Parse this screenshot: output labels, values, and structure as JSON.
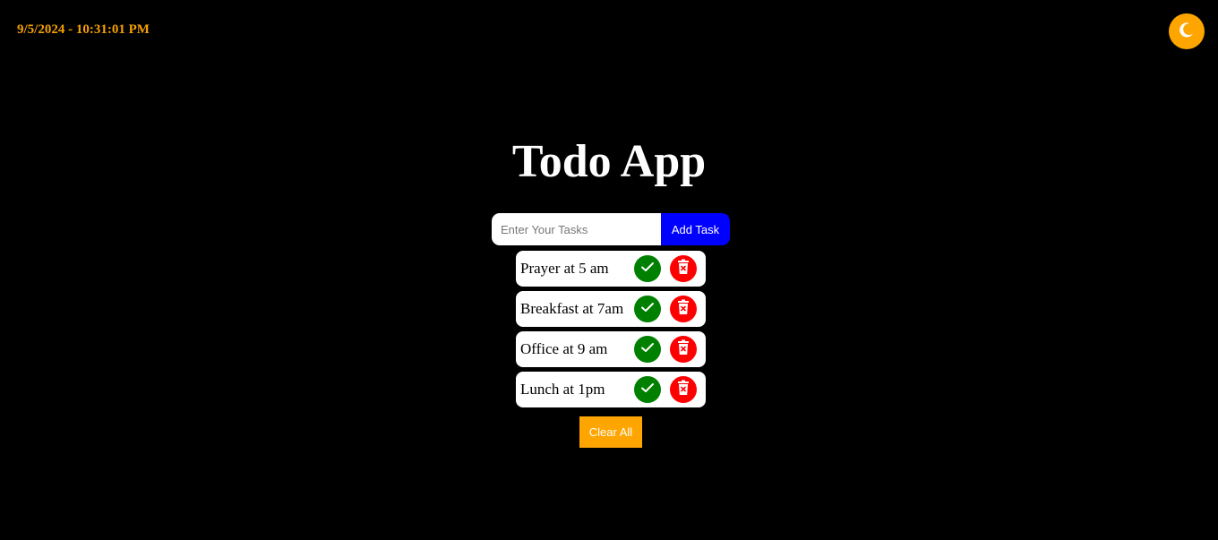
{
  "header": {
    "datetime": "9/5/2024 - 10:31:01 PM",
    "theme_toggle_icon": "moon-icon"
  },
  "main": {
    "title": "Todo App",
    "input": {
      "placeholder": "Enter Your Tasks",
      "value": ""
    },
    "add_button_label": "Add Task",
    "tasks": [
      {
        "text": "Prayer at 5 am",
        "done_icon": "check-icon",
        "delete_icon": "trash-icon"
      },
      {
        "text": "Breakfast at 7am",
        "done_icon": "check-icon",
        "delete_icon": "trash-icon"
      },
      {
        "text": "Office at 9 am",
        "done_icon": "check-icon",
        "delete_icon": "trash-icon"
      },
      {
        "text": "Lunch at 1pm",
        "done_icon": "check-icon",
        "delete_icon": "trash-icon"
      }
    ],
    "clear_button_label": "Clear All"
  },
  "colors": {
    "background": "#000000",
    "datetime": "#f5a000",
    "accent_orange": "#ffa500",
    "add_button": "#0000ff",
    "done": "#008000",
    "delete": "#ff0000"
  }
}
